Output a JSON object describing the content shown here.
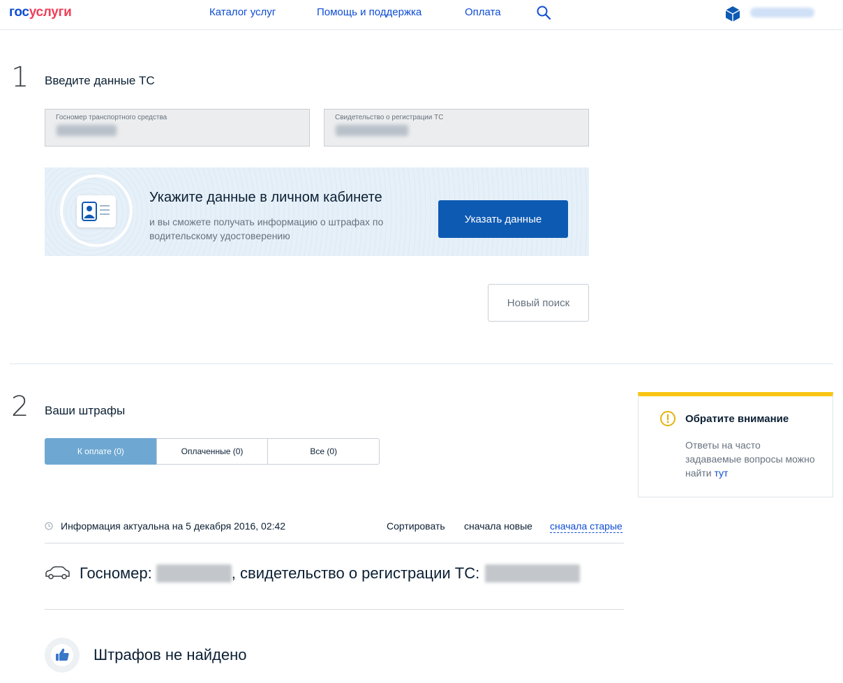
{
  "header": {
    "logo_part1": "гос",
    "logo_part2": "услуги",
    "nav": [
      "Каталог услуг",
      "Помощь и поддержка",
      "Оплата"
    ]
  },
  "step1": {
    "number": "1",
    "title": "Введите данные ТС",
    "fields": [
      {
        "label": "Госномер транспортного средства"
      },
      {
        "label": "Свидетельство о регистрации ТС"
      }
    ],
    "promo": {
      "title": "Укажите данные в личном кабинете",
      "text": "и вы сможете получать информацию о штрафах по водительскому удостоверению",
      "button": "Указать данные"
    },
    "new_search": "Новый поиск"
  },
  "step2": {
    "number": "2",
    "title": "Ваши штрафы",
    "tabs": [
      "К оплате (0)",
      "Оплаченные (0)",
      "Все (0)"
    ],
    "info": "Информация актуальна на 5 декабря 2016, 02:42",
    "sort_label": "Сортировать",
    "sort_new": "сначала новые",
    "sort_old": "сначала старые",
    "vehicle_prefix": "Госномер:",
    "vehicle_middle": ", свидетельство о регистрации ТС:",
    "empty": "Штрафов не найдено"
  },
  "notice": {
    "title": "Обратите внимание",
    "text": "Ответы на часто задаваемые вопросы можно найти",
    "link": "тут"
  },
  "colors": {
    "brand_blue": "#0d4cd3",
    "brand_red": "#ee3f58",
    "button_blue": "#0d5ab3",
    "tab_active": "#6ea8d2",
    "notice_yellow": "#f8c512"
  }
}
